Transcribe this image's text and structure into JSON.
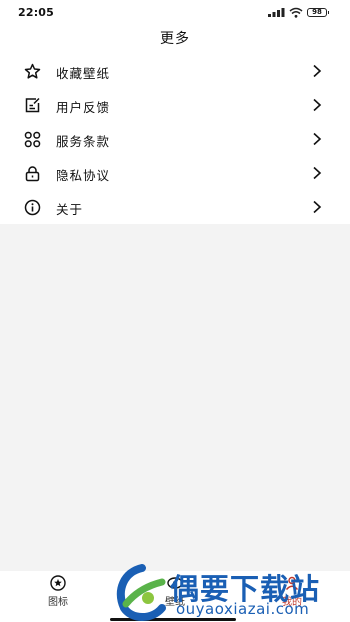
{
  "status_bar": {
    "time": "22:05",
    "battery": "98"
  },
  "header": {
    "title": "更多"
  },
  "menu": [
    {
      "label": "收藏壁纸",
      "icon": "star-icon"
    },
    {
      "label": "用户反馈",
      "icon": "feedback-icon"
    },
    {
      "label": "服务条款",
      "icon": "grid-icon"
    },
    {
      "label": "隐私协议",
      "icon": "lock-icon"
    },
    {
      "label": "关于",
      "icon": "info-icon"
    }
  ],
  "tabs": [
    {
      "label": "图标",
      "icon": "star-circle-icon"
    },
    {
      "label": "壁纸",
      "icon": "wallpaper-icon"
    },
    {
      "label": "我的",
      "icon": "user-icon"
    }
  ],
  "watermark": {
    "brand": "偶要下载站",
    "url": "ouyaoxiazai.com"
  },
  "colors": {
    "watermark": "#1a5fb4",
    "background": "#f3f3f3"
  }
}
